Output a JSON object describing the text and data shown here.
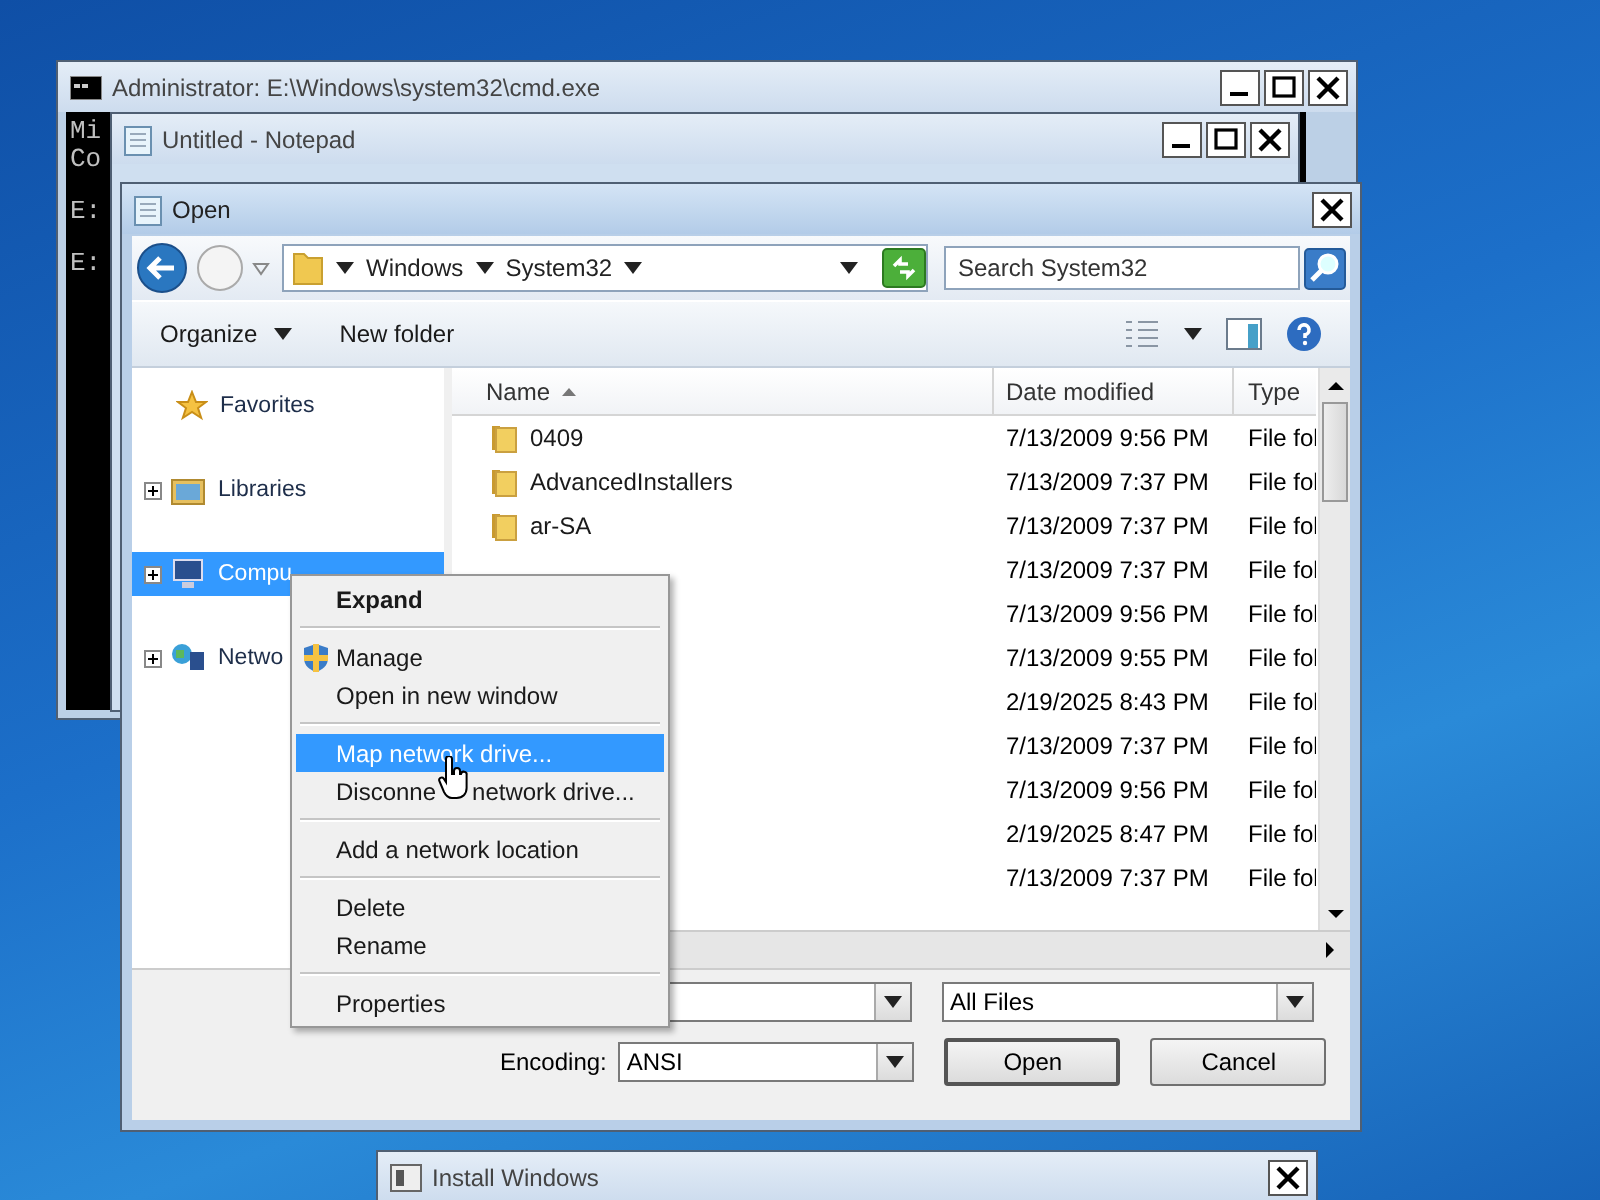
{
  "cmd_window": {
    "title": "Administrator: E:\\Windows\\system32\\cmd.exe",
    "console_blocks": [
      [
        "Mi",
        "Co"
      ],
      [
        "E:"
      ],
      [
        "E:"
      ]
    ]
  },
  "notepad_window": {
    "title": "Untitled - Notepad"
  },
  "open_dialog": {
    "title": "Open",
    "address": {
      "crumbs": [
        "Windows",
        "System32"
      ]
    },
    "search": {
      "placeholder": "Search System32"
    },
    "toolbar": {
      "organize": "Organize",
      "new_folder": "New folder"
    },
    "nav_pane": [
      {
        "label": "Favorites",
        "kind": "star",
        "selected": false
      },
      {
        "label": "Libraries",
        "kind": "libraries",
        "selected": false,
        "expanded": false
      },
      {
        "label": "Compu",
        "kind": "computer",
        "selected": true,
        "expanded": false
      },
      {
        "label": "Netwo",
        "kind": "network",
        "selected": false,
        "expanded": false
      }
    ],
    "columns": [
      "Name",
      "Date modified",
      "Type"
    ],
    "rows": [
      {
        "name": "0409",
        "date": "7/13/2009 9:56 PM",
        "type": "File fol"
      },
      {
        "name": "AdvancedInstallers",
        "date": "7/13/2009 7:37 PM",
        "type": "File fol"
      },
      {
        "name": "ar-SA",
        "date": "7/13/2009 7:37 PM",
        "type": "File fol"
      },
      {
        "date": "7/13/2009 7:37 PM",
        "type": "File fol"
      },
      {
        "date": "7/13/2009 9:56 PM",
        "type": "File fol"
      },
      {
        "date": "7/13/2009 9:55 PM",
        "type": "File fol"
      },
      {
        "date": "2/19/2025 8:43 PM",
        "type": "File fol"
      },
      {
        "date": "7/13/2009 7:37 PM",
        "type": "File fol"
      },
      {
        "date": "7/13/2009 9:56 PM",
        "type": "File fol"
      },
      {
        "date": "2/19/2025 8:47 PM",
        "type": "File fol"
      },
      {
        "date": "7/13/2009 7:37 PM",
        "type": "File fol"
      }
    ],
    "file_type": "All Files",
    "encoding": {
      "label": "Encoding:",
      "value": "ANSI"
    },
    "buttons": [
      "Open",
      "Cancel"
    ]
  },
  "install_window": {
    "title": "Install Windows"
  },
  "context_menu": [
    [
      {
        "label": "Expand",
        "kind": "default",
        "selected": false
      }
    ],
    [
      {
        "label": "Manage",
        "kind": "shield",
        "selected": false
      },
      {
        "label": "Open in new window",
        "kind": "plain",
        "selected": false
      }
    ],
    [
      {
        "label": "Map network drive...",
        "kind": "plain",
        "selected": true
      },
      {
        "parts": [
          "Disconne",
          "network drive..."
        ],
        "kind": "plain",
        "selected": false
      }
    ],
    [
      {
        "label": "Add a network location",
        "kind": "plain",
        "selected": false
      }
    ],
    [
      {
        "label": "Delete",
        "kind": "plain",
        "selected": false
      },
      {
        "label": "Rename",
        "kind": "plain",
        "selected": false
      }
    ],
    [
      {
        "label": "Properties",
        "kind": "plain",
        "selected": false
      }
    ]
  ]
}
